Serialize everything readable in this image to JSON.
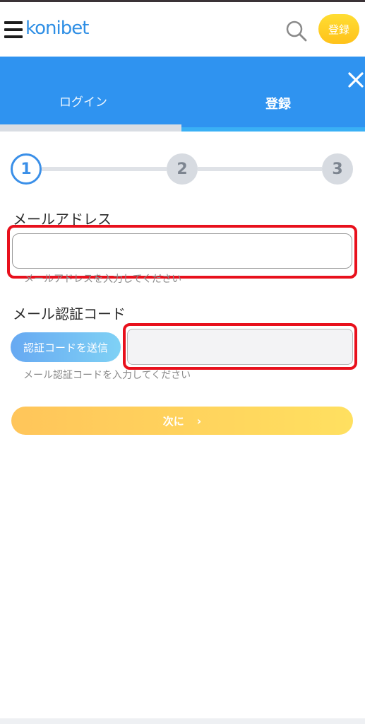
{
  "header": {
    "logo_text": "konibet",
    "register_label": "登録",
    "menu_icon": "menu-icon",
    "search_icon": "search-icon"
  },
  "tabs": {
    "login_label": "ログイン",
    "register_label": "登録",
    "active": "register",
    "close_icon": "close-icon"
  },
  "steps": [
    "1",
    "2",
    "3"
  ],
  "form": {
    "email_label": "メールアドレス",
    "email_value": "",
    "email_hint": "メールアドレスを入力してください",
    "code_label": "メール認証コード",
    "send_code_label": "認証コードを送信",
    "code_value": "",
    "code_hint": "メール認証コードを入力してください",
    "next_label": "次に"
  },
  "colors": {
    "primary_blue": "#2f93f0",
    "accent_yellow": "#ffd340",
    "highlight_red": "#e8101c"
  }
}
